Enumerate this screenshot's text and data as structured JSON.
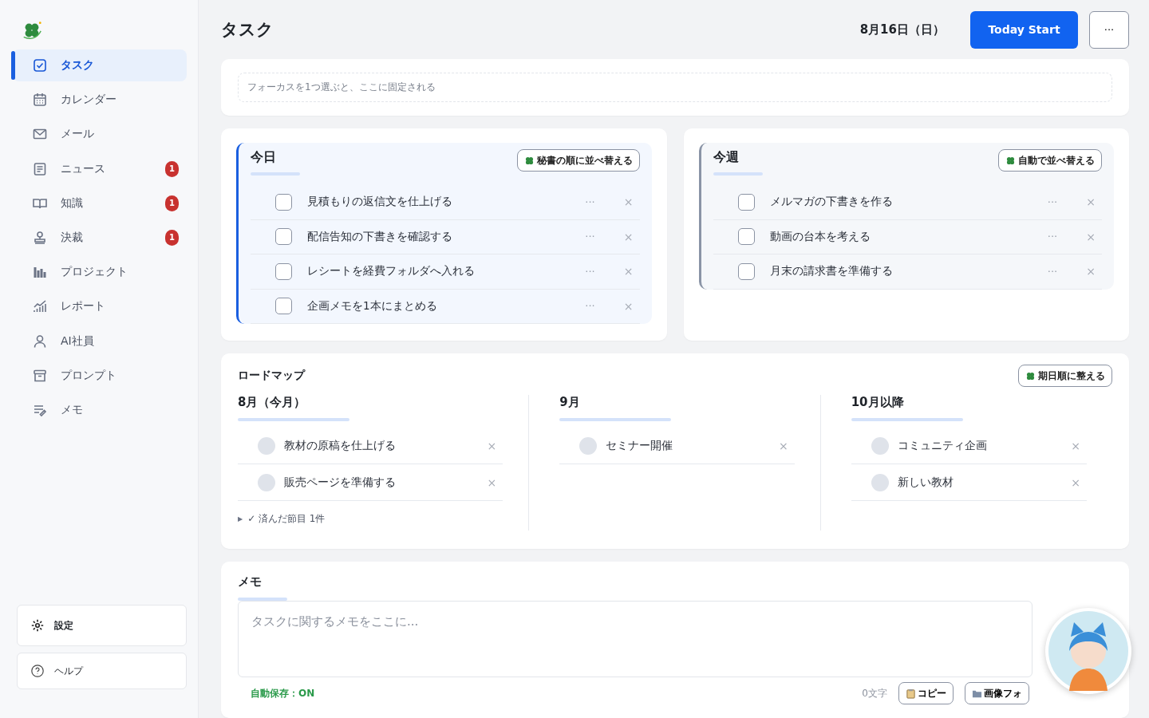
{
  "sidebar": {
    "items": [
      {
        "label": "タスク",
        "selected": true
      },
      {
        "label": "カレンダー",
        "selected": false
      },
      {
        "label": "メール",
        "selected": false
      },
      {
        "label": "ニュース",
        "selected": false,
        "badge": "1"
      },
      {
        "label": "知識",
        "selected": false,
        "badge": "1"
      },
      {
        "label": "決裁",
        "selected": false,
        "badge": "1"
      },
      {
        "label": "プロジェクト",
        "selected": false
      },
      {
        "label": "レポート",
        "selected": false
      },
      {
        "label": "AI社員",
        "selected": false
      },
      {
        "label": "プロンプト",
        "selected": false
      },
      {
        "label": "メモ",
        "selected": false
      }
    ],
    "footer": [
      {
        "label": "設定"
      },
      {
        "label": "ヘルプ"
      }
    ]
  },
  "header": {
    "title": "タスク",
    "date": "8月16日（日）",
    "primary_button": "Today Start",
    "more_button": "···"
  },
  "focus": {
    "placeholder": "フォーカスを1つ選ぶと、ここに固定される"
  },
  "task_lists": [
    {
      "title": "今日",
      "sort_button": "秘書の順に並べ替える",
      "tasks": [
        {
          "text": "見積もりの返信文を仕上げる",
          "checked": false,
          "more": "···",
          "remove": "×"
        },
        {
          "text": "配信告知の下書きを確認する",
          "checked": false,
          "more": "···",
          "remove": "×"
        },
        {
          "text": "レシートを経費フォルダへ入れる",
          "checked": false,
          "more": "···",
          "remove": "×"
        },
        {
          "text": "企画メモを1本にまとめる",
          "checked": false,
          "more": "···",
          "remove": "×"
        }
      ]
    },
    {
      "title": "今週",
      "sort_button": "自動で並べ替える",
      "tasks": [
        {
          "text": "メルマガの下書きを作る",
          "checked": false,
          "more": "···",
          "remove": "×"
        },
        {
          "text": "動画の台本を考える",
          "checked": false,
          "more": "···",
          "remove": "×"
        },
        {
          "text": "月末の請求書を準備する",
          "checked": false,
          "more": "···",
          "remove": "×"
        }
      ]
    }
  ],
  "roadmap": {
    "title": "ロードマップ",
    "sort_button": "期日順に整える",
    "columns": [
      {
        "title": "8月（今月）",
        "items": [
          {
            "text": "教材の原稿を仕上げる",
            "remove": "×"
          },
          {
            "text": "販売ページを準備する",
            "remove": "×"
          }
        ],
        "done_toggle": {
          "arrow": "▶",
          "label": "✓ 済んだ節目 1件",
          "expanded": false
        }
      },
      {
        "title": "9月",
        "items": [
          {
            "text": "セミナー開催",
            "remove": "×"
          }
        ]
      },
      {
        "title": "10月以降",
        "items": [
          {
            "text": "コミュニティ企画",
            "remove": "×"
          },
          {
            "text": "新しい教材",
            "remove": "×"
          }
        ]
      }
    ]
  },
  "memo": {
    "title": "メモ",
    "placeholder": "タスクに関するメモをここに...",
    "autosave": "自動保存：ON",
    "char_count": "0文字",
    "buttons": [
      "コピー",
      "画像フォ"
    ]
  }
}
